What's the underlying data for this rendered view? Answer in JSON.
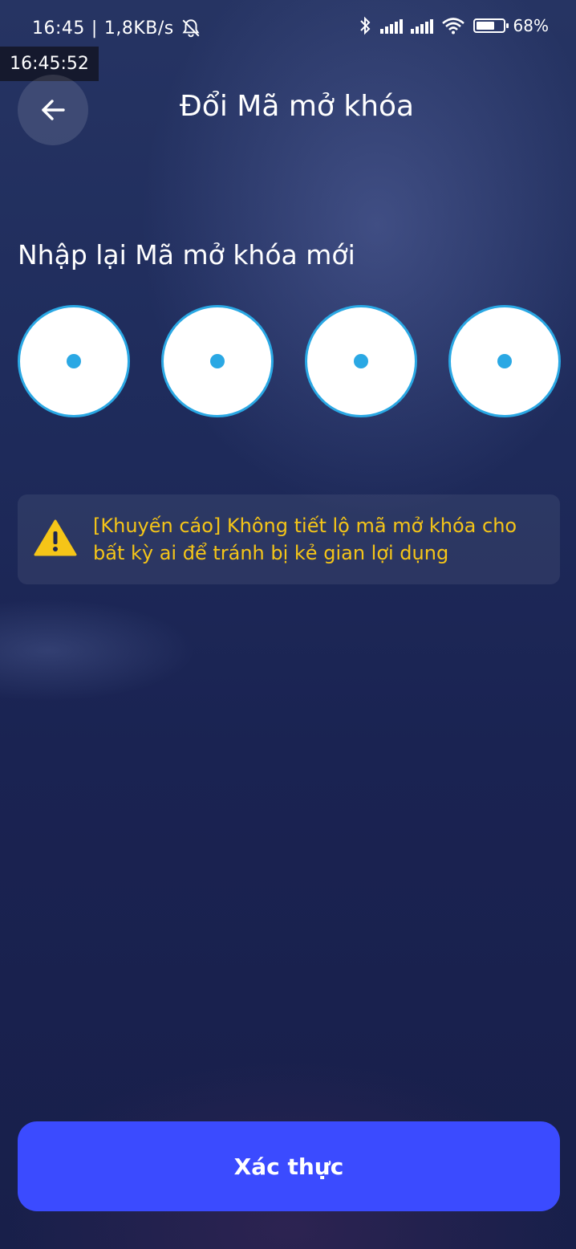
{
  "status_bar": {
    "time": "16:45",
    "separator": "|",
    "net_speed": "1,8KB/s",
    "battery_percent": "68%",
    "battery_level": 0.68
  },
  "time_overlay": "16:45:52",
  "header": {
    "title": "Đổi Mã mở khóa"
  },
  "prompt": "Nhập lại Mã mở khóa mới",
  "pin": {
    "length": 4,
    "entered": 4
  },
  "warning": {
    "text": "[Khuyến cáo] Không tiết lộ mã mở khóa cho bất kỳ ai để tránh bị kẻ gian lợi dụng"
  },
  "actions": {
    "confirm_label": "Xác thực"
  },
  "colors": {
    "accent": "#3b4bff",
    "pin_border": "#2aa8e4",
    "warning": "#f5c518"
  },
  "icons": {
    "back": "arrow-left-icon",
    "warning": "warning-triangle-icon"
  }
}
